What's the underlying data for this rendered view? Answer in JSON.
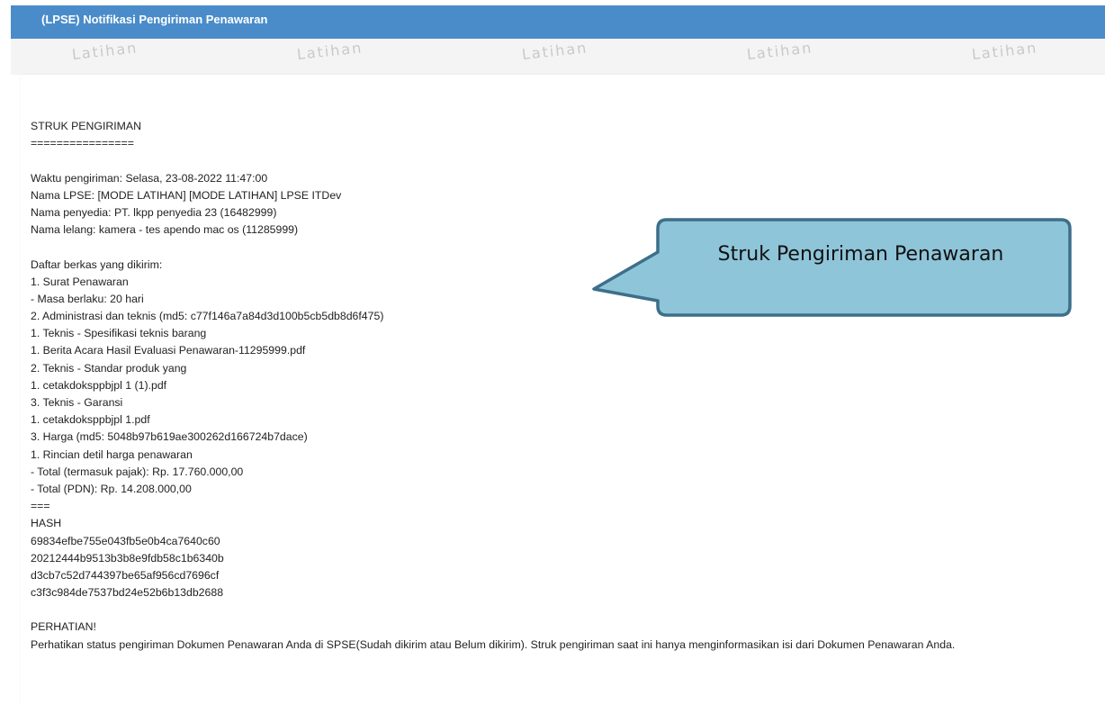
{
  "header": {
    "title": "(LPSE) Notifikasi Pengiriman Penawaran"
  },
  "watermark": {
    "text": "Latihan",
    "repeat": 5
  },
  "receipt": {
    "lines": [
      "STRUK PENGIRIMAN",
      "================",
      "",
      "Waktu pengiriman: Selasa, 23-08-2022 11:47:00",
      "Nama LPSE: [MODE LATIHAN] [MODE LATIHAN] LPSE ITDev",
      "Nama penyedia: PT. lkpp penyedia 23 (16482999)",
      "Nama lelang: kamera - tes apendo mac os (11285999)",
      "",
      "Daftar berkas yang dikirim:",
      "1. Surat Penawaran",
      "- Masa berlaku: 20 hari",
      "2. Administrasi dan teknis (md5: c77f146a7a84d3d100b5cb5db8d6f475)",
      "1. Teknis - Spesifikasi teknis barang",
      "1. Berita Acara Hasil Evaluasi Penawaran-11295999.pdf",
      "2. Teknis - Standar produk yang",
      "1. cetakdoksppbjpl 1 (1).pdf",
      "3. Teknis - Garansi",
      "1. cetakdoksppbjpl 1.pdf",
      "3. Harga (md5: 5048b97b619ae300262d166724b7dace)",
      "1. Rincian detil harga penawaran",
      "- Total (termasuk pajak): Rp. 17.760.000,00",
      "- Total (PDN): Rp. 14.208.000,00",
      "===",
      "HASH",
      "69834efbe755e043fb5e0b4ca7640c60",
      "20212444b9513b3b8e9fdb58c1b6340b",
      "d3cb7c52d744397be65af956cd7696cf",
      "c3f3c984de7537bd24e52b6b13db2688",
      "",
      "PERHATIAN!",
      "Perhatikan status pengiriman Dokumen Penawaran Anda di SPSE(Sudah dikirim atau Belum dikirim). Struk pengiriman saat ini hanya menginformasikan isi dari Dokumen Penawaran Anda."
    ]
  },
  "callout": {
    "text": "Struk Pengiriman Penawaran",
    "fill": "#8fc5d9",
    "stroke": "#3d6f8a"
  },
  "colors": {
    "header_bg": "#4a8cc9",
    "page_bg": "#f4f4f4",
    "watermark": "#c9c9c9"
  }
}
